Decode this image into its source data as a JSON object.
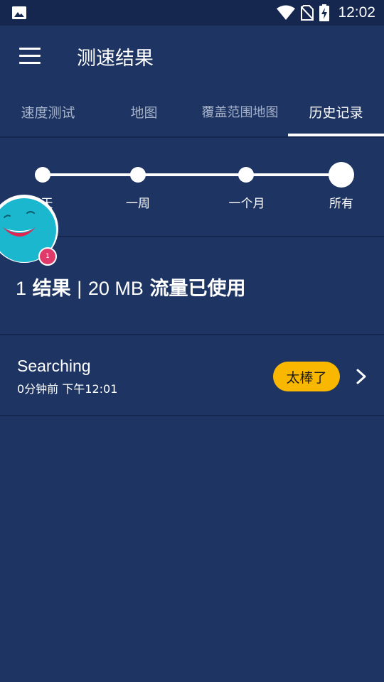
{
  "status_bar": {
    "time": "12:02",
    "icons": [
      "gallery-icon",
      "wifi-icon",
      "no-sim-icon",
      "battery-charging-icon"
    ]
  },
  "app_bar": {
    "title": "测速结果",
    "menu_icon": "hamburger-menu-icon"
  },
  "tabs": [
    {
      "label": "速度测试",
      "active": false
    },
    {
      "label": "地图",
      "active": false
    },
    {
      "label": "覆盖范围地图",
      "active": false
    },
    {
      "label": "历史记录",
      "active": true
    }
  ],
  "filter": {
    "options": [
      "天",
      "一周",
      "一个月",
      "所有"
    ],
    "selected": "所有"
  },
  "summary": {
    "count": "1",
    "results_label": "结果",
    "separator": "|",
    "data_amount": "20 MB",
    "data_label": "流量已使用"
  },
  "results": [
    {
      "title": "Searching",
      "time": "0分钟前 下午12:01",
      "rating": "太棒了",
      "rating_color": "#f9b700"
    }
  ],
  "mascot": {
    "badge_count": "1",
    "color": "#1bb7cf"
  },
  "colors": {
    "background": "#1e3563",
    "status_bar": "#15274f",
    "divider": "#13264e",
    "inactive_tab": "#a6b2c9",
    "badge": "#e03a6a"
  }
}
